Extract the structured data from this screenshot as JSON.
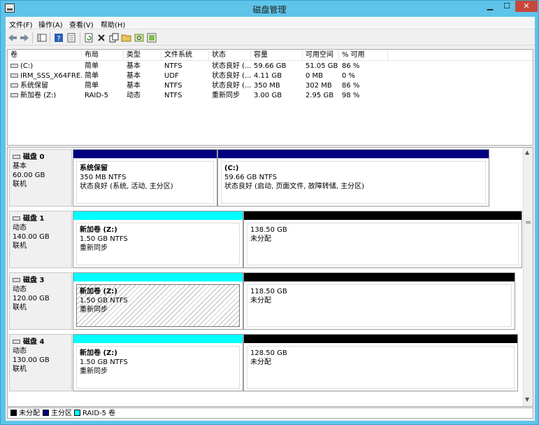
{
  "window": {
    "title": "磁盘管理",
    "min": "▁",
    "max": "☐",
    "close": "✕"
  },
  "menu": [
    "文件(F)",
    "操作(A)",
    "查看(V)",
    "帮助(H)"
  ],
  "columns": [
    "卷",
    "布局",
    "类型",
    "文件系统",
    "状态",
    "容量",
    "可用空间",
    "% 可用"
  ],
  "volumes": [
    [
      "(C:)",
      "简单",
      "基本",
      "NTFS",
      "状态良好 (...",
      "59.66 GB",
      "51.05 GB",
      "86 %"
    ],
    [
      "IRM_SSS_X64FRE...",
      "简单",
      "基本",
      "UDF",
      "状态良好 (...",
      "4.11 GB",
      "0 MB",
      "0 %"
    ],
    [
      "系统保留",
      "简单",
      "基本",
      "NTFS",
      "状态良好 (...",
      "350 MB",
      "302 MB",
      "86 %"
    ],
    [
      "新加卷 (Z:)",
      "RAID-5",
      "动态",
      "NTFS",
      "重新同步",
      "3.00 GB",
      "2.95 GB",
      "98 %"
    ]
  ],
  "disks": [
    {
      "name": "磁盘 0",
      "type": "基本",
      "size": "60.00 GB",
      "status": "联机",
      "parts": [
        {
          "name": "系统保留",
          "fs": "350 MB NTFS",
          "state": "状态良好 (系统, 活动, 主分区)"
        },
        {
          "name": "(C:)",
          "fs": "59.66 GB NTFS",
          "state": "状态良好 (启动, 页面文件, 故障转储, 主分区)"
        }
      ]
    },
    {
      "name": "磁盘 1",
      "type": "动态",
      "size": "140.00 GB",
      "status": "联机",
      "parts": [
        {
          "name": "新加卷  (Z:)",
          "fs": "1.50 GB NTFS",
          "state": "重新同步"
        },
        {
          "name": "",
          "fs": "138.50 GB",
          "state": "未分配"
        }
      ]
    },
    {
      "name": "磁盘 3",
      "type": "动态",
      "size": "120.00 GB",
      "status": "联机",
      "parts": [
        {
          "name": "新加卷  (Z:)",
          "fs": "1.50 GB NTFS",
          "state": "重新同步"
        },
        {
          "name": "",
          "fs": "118.50 GB",
          "state": "未分配"
        }
      ]
    },
    {
      "name": "磁盘 4",
      "type": "动态",
      "size": "130.00 GB",
      "status": "联机",
      "parts": [
        {
          "name": "新加卷  (Z:)",
          "fs": "1.50 GB NTFS",
          "state": "重新同步"
        },
        {
          "name": "",
          "fs": "128.50 GB",
          "state": "未分配"
        }
      ]
    }
  ],
  "legend": [
    {
      "label": "未分配",
      "color": "#000000"
    },
    {
      "label": "主分区",
      "color": "#000080"
    },
    {
      "label": "RAID-5 卷",
      "color": "#00ffff"
    }
  ],
  "colors": {
    "primary": "#000080",
    "unallocated": "#000000",
    "raid5": "#00ffff"
  }
}
